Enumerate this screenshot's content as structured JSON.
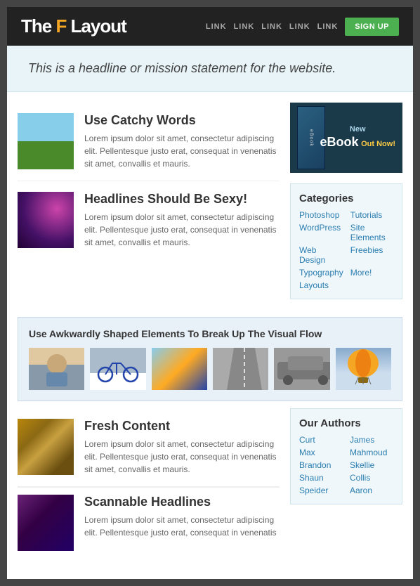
{
  "header": {
    "logo_the": "The ",
    "logo_f": "F",
    "logo_layout": " Layout",
    "nav": [
      {
        "label": "LINK"
      },
      {
        "label": "LINK"
      },
      {
        "label": "LINK"
      },
      {
        "label": "LINK"
      },
      {
        "label": "LINK"
      }
    ],
    "signup_label": "SIGN UP"
  },
  "hero": {
    "text": "This is a headline or mission statement for the website."
  },
  "articles": [
    {
      "title": "Use Catchy Words",
      "body": "Lorem ipsum dolor sit amet, consectetur adipiscing elit. Pellentesque justo erat, consequat in venenatis sit amet, convallis et mauris."
    },
    {
      "title": "Headlines Should Be Sexy!",
      "body": "Lorem ipsum dolor sit amet, consectetur adipiscing elit. Pellentesque justo erat, consequat in venenatis sit amet, convallis et mauris."
    }
  ],
  "promo": {
    "new_label": "New",
    "ebook_label": "eBook",
    "out_now": "Out Now!"
  },
  "categories": {
    "title": "Categories",
    "links": [
      "Photoshop",
      "Tutorials",
      "WordPress",
      "Site Elements",
      "Web Design",
      "Freebies",
      "Typography",
      "More!",
      "Layouts",
      ""
    ]
  },
  "visual_flow": {
    "title": "Use Awkwardly Shaped Elements To Break Up The Visual Flow"
  },
  "bottom_articles": [
    {
      "title": "Fresh Content",
      "body": "Lorem ipsum dolor sit amet, consectetur adipiscing elit. Pellentesque justo erat, consequat in venenatis sit amet, convallis et mauris."
    },
    {
      "title": "Scannable Headlines",
      "body": "Lorem ipsum dolor sit amet, consectetur adipiscing elit. Pellentesque justo erat, consequat in venenatis"
    }
  ],
  "authors": {
    "title": "Our Authors",
    "names": [
      "Curt",
      "James",
      "Max",
      "Mahmoud",
      "Brandon",
      "Skellie",
      "Shaun",
      "Collis",
      "Speider",
      "Aaron"
    ]
  }
}
